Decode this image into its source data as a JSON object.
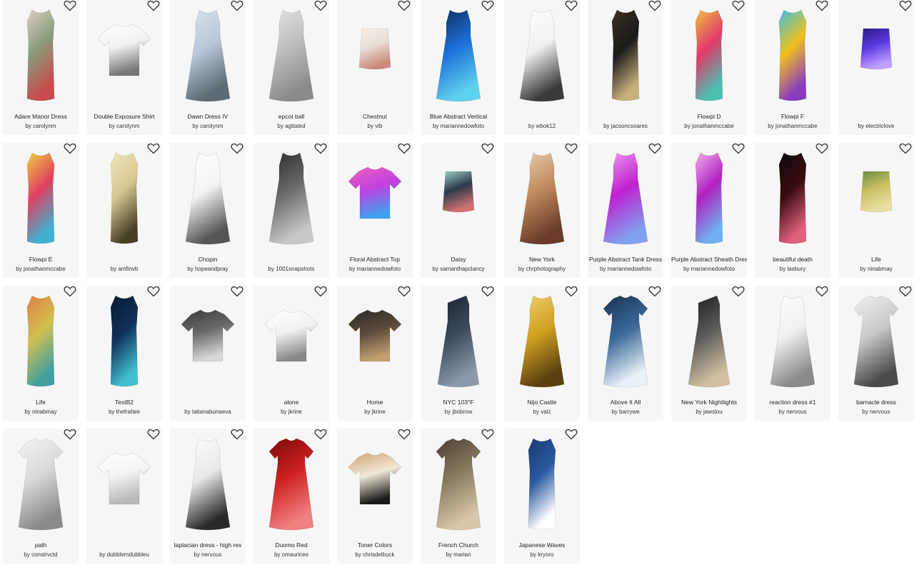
{
  "items": [
    {
      "title": "Adare Manor Dress",
      "by": "by",
      "author": "carolynm",
      "shape": "sheath",
      "colors": [
        "#8a9a7a",
        "#c84a4a",
        "#d9d0c4"
      ]
    },
    {
      "title": "Double Exposure Shirt",
      "by": "by",
      "author": "carolynm",
      "shape": "tee",
      "colors": [
        "#f2f2f2",
        "#777777",
        "#ffffff"
      ]
    },
    {
      "title": "Dawn Dress IV",
      "by": "by",
      "author": "carolynm",
      "shape": "aline",
      "colors": [
        "#b8c8d8",
        "#5c6a74",
        "#d9e2ea"
      ]
    },
    {
      "title": "epcot ball",
      "by": "by",
      "author": "agitated",
      "shape": "aline",
      "colors": [
        "#bdbdbd",
        "#8a8a8a",
        "#e4e4e4"
      ]
    },
    {
      "title": "Chestnut",
      "by": "by",
      "author": "vib",
      "shape": "skirt",
      "colors": [
        "#e8ded6",
        "#c98a7a",
        "#f5efe9"
      ]
    },
    {
      "title": "Blue Abstract Vertical",
      "by": "by",
      "author": "mariannedowfoto",
      "shape": "aline",
      "colors": [
        "#1c6fd8",
        "#5fd1f0",
        "#0b2b5a"
      ]
    },
    {
      "title": "",
      "by": "by",
      "author": "wbok12",
      "shape": "aline",
      "colors": [
        "#f0f0f0",
        "#3a3a3a",
        "#ffffff"
      ]
    },
    {
      "title": "",
      "by": "by",
      "author": "jacsoncsoares",
      "shape": "sheath",
      "colors": [
        "#1a1a1a",
        "#c8b07a",
        "#3a3020"
      ]
    },
    {
      "title": "Flowpi D",
      "by": "by",
      "author": "jonathanmccabe",
      "shape": "sheath",
      "colors": [
        "#e03a6a",
        "#4ac0b0",
        "#f2c040"
      ]
    },
    {
      "title": "Flowpi F",
      "by": "by",
      "author": "jonathanmccabe",
      "shape": "sheath",
      "colors": [
        "#f0c020",
        "#8a3ac0",
        "#3ac0e0"
      ]
    },
    {
      "title": "",
      "by": "by",
      "author": "electriclove",
      "shape": "skirt",
      "colors": [
        "#5a3ae0",
        "#c0a0ff",
        "#2a1a80"
      ]
    },
    {
      "title": "Flowpi E",
      "by": "by",
      "author": "jonathanmccabe",
      "shape": "sheath",
      "colors": [
        "#e04060",
        "#40b0d0",
        "#f0d040"
      ]
    },
    {
      "title": "",
      "by": "by",
      "author": "amfinvb",
      "shape": "sheath",
      "colors": [
        "#d6c890",
        "#4a4028",
        "#efe6c0"
      ]
    },
    {
      "title": "Chopin",
      "by": "by",
      "author": "hopeandpray",
      "shape": "aline",
      "colors": [
        "#f4f4f4",
        "#555555",
        "#ffffff"
      ]
    },
    {
      "title": "",
      "by": "by",
      "author": "1001snapshots",
      "shape": "aline",
      "colors": [
        "#6a6a6a",
        "#c8c8c8",
        "#2a2a2a"
      ]
    },
    {
      "title": "Floral Abstract Top",
      "by": "by",
      "author": "mariannedowfoto",
      "shape": "tee",
      "colors": [
        "#c040e0",
        "#40a0f0",
        "#f060c0"
      ]
    },
    {
      "title": "Daisy",
      "by": "by",
      "author": "samanthapclancy",
      "shape": "skirt",
      "colors": [
        "#2a3a4a",
        "#d07070",
        "#a0d0c0"
      ]
    },
    {
      "title": "New York",
      "by": "by",
      "author": "chrphotography",
      "shape": "aline",
      "colors": [
        "#c08a5a",
        "#6a3a2a",
        "#e8d0b0"
      ]
    },
    {
      "title": "Purple Abstract Tank Dress",
      "by": "by",
      "author": "mariannedowfoto",
      "shape": "aline",
      "colors": [
        "#c020d0",
        "#80a0f0",
        "#f0a0f0"
      ]
    },
    {
      "title": "Purple Abstract Sheath Dress",
      "by": "by",
      "author": "mariannedowfoto",
      "shape": "sheath",
      "colors": [
        "#b020c0",
        "#70b0f0",
        "#f0b0f0"
      ]
    },
    {
      "title": "beautiful death",
      "by": "by",
      "author": "lasbury",
      "shape": "sheath",
      "colors": [
        "#3a0a10",
        "#e06080",
        "#0a0a0a"
      ]
    },
    {
      "title": "Life",
      "by": "by",
      "author": "ninabmay",
      "shape": "skirt",
      "colors": [
        "#c8c060",
        "#e8e0a0",
        "#6a8a40"
      ]
    },
    {
      "title": "Life",
      "by": "by",
      "author": "ninabmay",
      "shape": "sheath",
      "colors": [
        "#d0c050",
        "#40a0a0",
        "#e08040"
      ]
    },
    {
      "title": "TestB2",
      "by": "by",
      "author": "thefrafaie",
      "shape": "sheath",
      "colors": [
        "#10305a",
        "#40c0d0",
        "#0a1a30"
      ]
    },
    {
      "title": "",
      "by": "by",
      "author": "tatianabunaeva",
      "shape": "tee",
      "colors": [
        "#6a6a6a",
        "#d8d8d8",
        "#3a3a3a"
      ]
    },
    {
      "title": "alone",
      "by": "by",
      "author": "jkrine",
      "shape": "tee",
      "colors": [
        "#f2f2f2",
        "#888888",
        "#ffffff"
      ]
    },
    {
      "title": "Home",
      "by": "by",
      "author": "jkrine",
      "shape": "tee",
      "colors": [
        "#5a4a3a",
        "#c0a070",
        "#2a2a2a"
      ]
    },
    {
      "title": "NYC 103°F",
      "by": "by",
      "author": "jbobrow",
      "shape": "oneshoulder",
      "colors": [
        "#3a4a5a",
        "#8a9aaa",
        "#1a2030"
      ]
    },
    {
      "title": "Nijo Castle",
      "by": "by",
      "author": "valz",
      "shape": "aline",
      "colors": [
        "#d0a020",
        "#5a4010",
        "#f0d070"
      ]
    },
    {
      "title": "Above It All",
      "by": "by",
      "author": "barrywe",
      "shape": "teedress",
      "colors": [
        "#3a6a9a",
        "#e8f0f8",
        "#1a3050"
      ]
    },
    {
      "title": "New York Nightlights",
      "by": "by",
      "author": "jawslou",
      "shape": "oneshoulder",
      "colors": [
        "#5a5a5a",
        "#d0c0a0",
        "#1a1a1a"
      ]
    },
    {
      "title": "reaction dress #1",
      "by": "by",
      "author": "nervous",
      "shape": "aline",
      "colors": [
        "#f0f0f0",
        "#8a8a8a",
        "#ffffff"
      ]
    },
    {
      "title": "barnacle dress",
      "by": "by",
      "author": "nervous",
      "shape": "teedress",
      "colors": [
        "#c8c8c8",
        "#4a4a4a",
        "#f0f0f0"
      ]
    },
    {
      "title": "path",
      "by": "by",
      "author": "constrvctd",
      "shape": "teedress",
      "colors": [
        "#d8d8d8",
        "#8a8a8a",
        "#f4f4f4"
      ]
    },
    {
      "title": "",
      "by": "by",
      "author": "dubblemdubbleu",
      "shape": "tee",
      "colors": [
        "#f4f4f4",
        "#b8b8b8",
        "#ffffff"
      ]
    },
    {
      "title": "laplacian dress - high res",
      "by": "by",
      "author": "nervous",
      "shape": "aline",
      "colors": [
        "#e8e8e8",
        "#2a2a2a",
        "#ffffff"
      ]
    },
    {
      "title": "Duomo Red",
      "by": "by",
      "author": "omauriceo",
      "shape": "teedress",
      "colors": [
        "#d02020",
        "#f08080",
        "#7a0a0a"
      ]
    },
    {
      "title": "Toner Colors",
      "by": "by",
      "author": "chrisdelbuck",
      "shape": "tee",
      "colors": [
        "#f0e8d8",
        "#1a1a1a",
        "#d0a070"
      ]
    },
    {
      "title": "French Church",
      "by": "by",
      "author": "marian",
      "shape": "teedress",
      "colors": [
        "#8a7a60",
        "#d8c8a8",
        "#4a4030"
      ]
    },
    {
      "title": "Japanese Waves",
      "by": "by",
      "author": "kryoro",
      "shape": "sheath",
      "colors": [
        "#2a5aa0",
        "#ffffff",
        "#1a3a70"
      ]
    }
  ]
}
